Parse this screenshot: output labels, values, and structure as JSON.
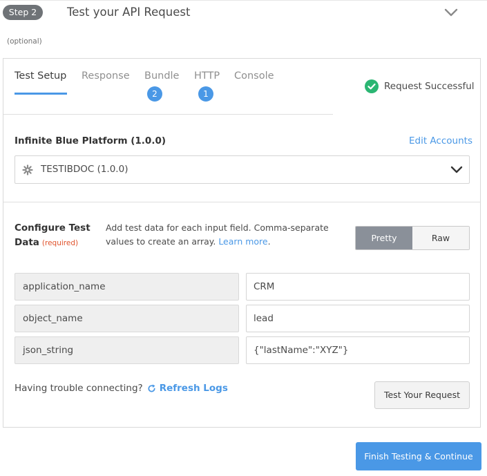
{
  "header": {
    "step_label": "Step 2",
    "title": "Test your API Request",
    "optional_note": "(optional)"
  },
  "tabs": [
    {
      "label": "Test Setup",
      "active": true
    },
    {
      "label": "Response",
      "active": false
    },
    {
      "label": "Bundle",
      "active": false,
      "count": "2"
    },
    {
      "label": "HTTP",
      "active": false,
      "count": "1"
    },
    {
      "label": "Console",
      "active": false
    }
  ],
  "status": {
    "text": "Request Successful",
    "icon": "check-circle-icon",
    "color": "#2bb673"
  },
  "account": {
    "label": "Infinite Blue Platform (1.0.0)",
    "edit_link": "Edit Accounts",
    "selected": "TESTIBDOC (1.0.0)"
  },
  "configure": {
    "title": "Configure Test Data",
    "required": "(required)",
    "help_text": "Add test data for each input field. Comma-separate values to create an array.",
    "learn_more": "Learn more",
    "help_suffix": ".",
    "toggle": {
      "pretty": "Pretty",
      "raw": "Raw",
      "selected": "Pretty"
    },
    "fields": [
      {
        "key": "application_name",
        "value": "CRM"
      },
      {
        "key": "object_name",
        "value": "lead"
      },
      {
        "key": "json_string",
        "value": "{\"lastName\":\"XYZ\"}"
      }
    ]
  },
  "footer": {
    "trouble_text": "Having trouble connecting?",
    "refresh_logs": "Refresh Logs",
    "test_button": "Test Your Request",
    "finish_button": "Finish Testing & Continue"
  },
  "colors": {
    "accent": "#4a98e6",
    "success": "#2bb673",
    "required": "#e0522b"
  }
}
